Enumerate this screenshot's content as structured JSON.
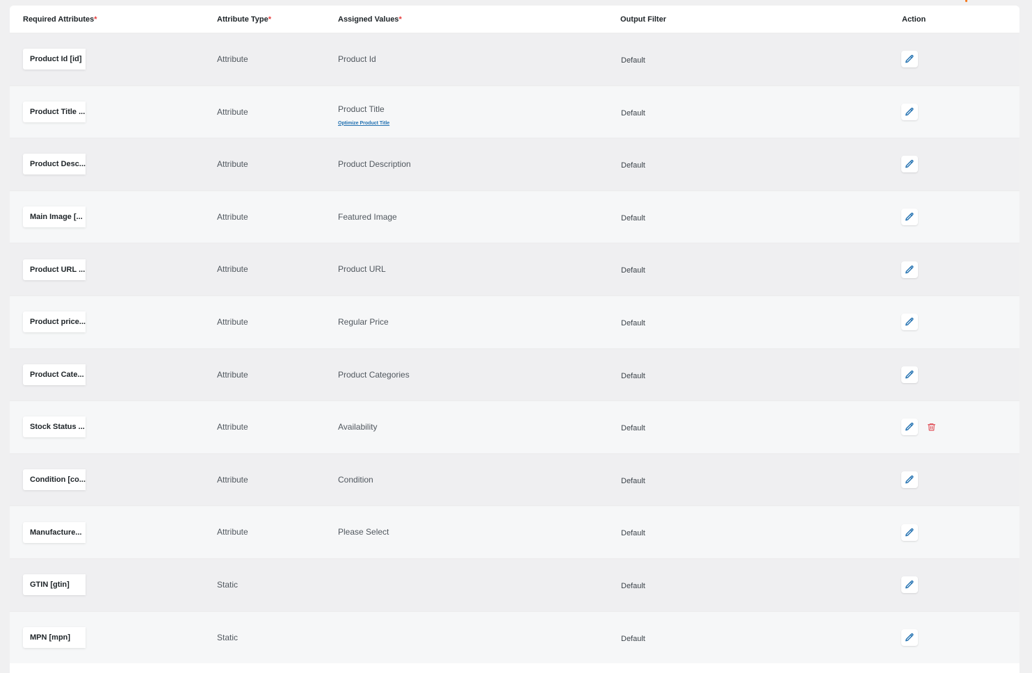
{
  "header": {
    "required_attributes": "Required Attributes",
    "attribute_type": "Attribute Type",
    "assigned_values": "Assigned Values",
    "output_filter": "Output Filter",
    "action": "Action",
    "required_marker": "*"
  },
  "colors": {
    "edit_icon": "#2271b1",
    "delete_icon": "#e0525a",
    "required": "#e63b3b",
    "accent": "#f5791f"
  },
  "rows": [
    {
      "attribute": "Product Id [id]",
      "type": "Attribute",
      "value": "Product Id",
      "filter": "Default"
    },
    {
      "attribute": "Product Title ...",
      "type": "Attribute",
      "value": "Product Title",
      "link": "Optimize Product Title",
      "filter": "Default"
    },
    {
      "attribute": "Product Desc...",
      "type": "Attribute",
      "value": "Product Description",
      "filter": "Default"
    },
    {
      "attribute": "Main Image [...",
      "type": "Attribute",
      "value": "Featured Image",
      "filter": "Default"
    },
    {
      "attribute": "Product URL ...",
      "type": "Attribute",
      "value": "Product URL",
      "filter": "Default"
    },
    {
      "attribute": "Product price...",
      "type": "Attribute",
      "value": "Regular Price",
      "filter": "Default"
    },
    {
      "attribute": "Product Cate...",
      "type": "Attribute",
      "value": "Product Categories",
      "filter": "Default"
    },
    {
      "attribute": "Stock Status ...",
      "type": "Attribute",
      "value": "Availability",
      "filter": "Default",
      "deletable": true
    },
    {
      "attribute": "Condition [co...",
      "type": "Attribute",
      "value": "Condition",
      "filter": "Default"
    },
    {
      "attribute": "Manufacture...",
      "type": "Attribute",
      "value": "Please Select",
      "filter": "Default"
    },
    {
      "attribute": "GTIN [gtin]",
      "type": "Static",
      "value": "",
      "filter": "Default"
    },
    {
      "attribute": "MPN [mpn]",
      "type": "Static",
      "value": "",
      "filter": "Default"
    }
  ],
  "icons": {
    "edit": "pencil-icon",
    "delete": "trash-icon"
  }
}
